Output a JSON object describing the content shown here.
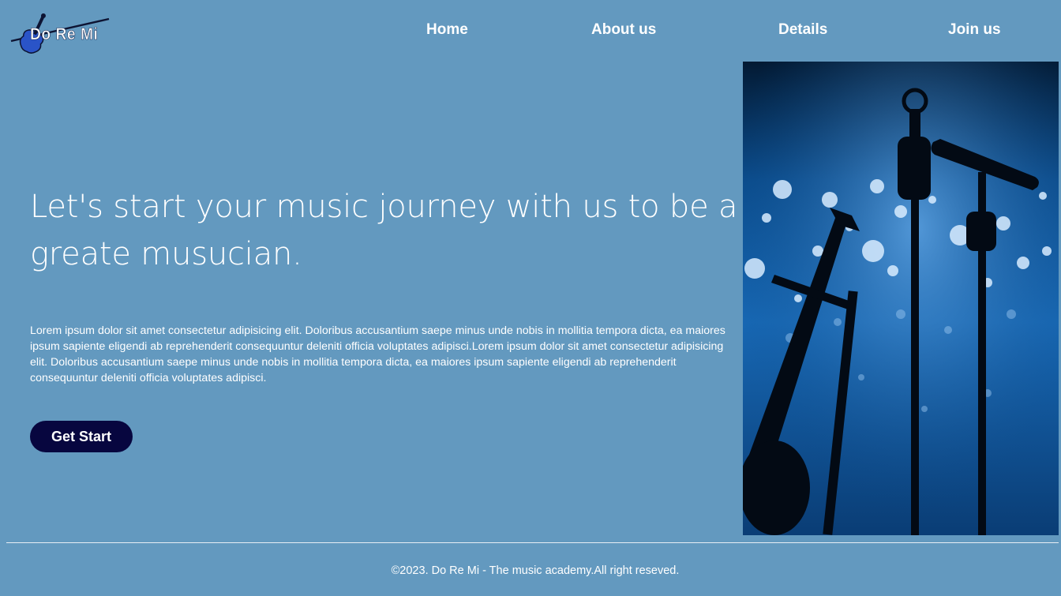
{
  "brand": {
    "name": "Do Re Mi",
    "logo_icon": "violin-icon"
  },
  "nav": {
    "items": [
      {
        "label": "Home"
      },
      {
        "label": "About us"
      },
      {
        "label": "Details"
      },
      {
        "label": "Join us"
      }
    ]
  },
  "hero": {
    "headline": "Let's start your music journey with us to be a greate musucian.",
    "body": "Lorem ipsum dolor sit amet consectetur adipisicing elit. Doloribus accusantium saepe minus unde nobis in mollitia tempora dicta, ea maiores ipsum sapiente eligendi ab reprehenderit consequuntur deleniti officia voluptates adipisci.Lorem ipsum dolor sit amet consectetur adipisicing elit. Doloribus accusantium saepe minus unde nobis in mollitia tempora dicta, ea maiores ipsum sapiente eligendi ab reprehenderit consequuntur deleniti officia voluptates adipisci.",
    "cta_label": "Get Start",
    "image_icon": "concert-stage-image"
  },
  "footer": {
    "text": "©2023. Do Re Mi - The music academy.All right reseved."
  },
  "colors": {
    "background": "#6399bf",
    "cta_background": "#07063f",
    "text": "#ffffff"
  }
}
